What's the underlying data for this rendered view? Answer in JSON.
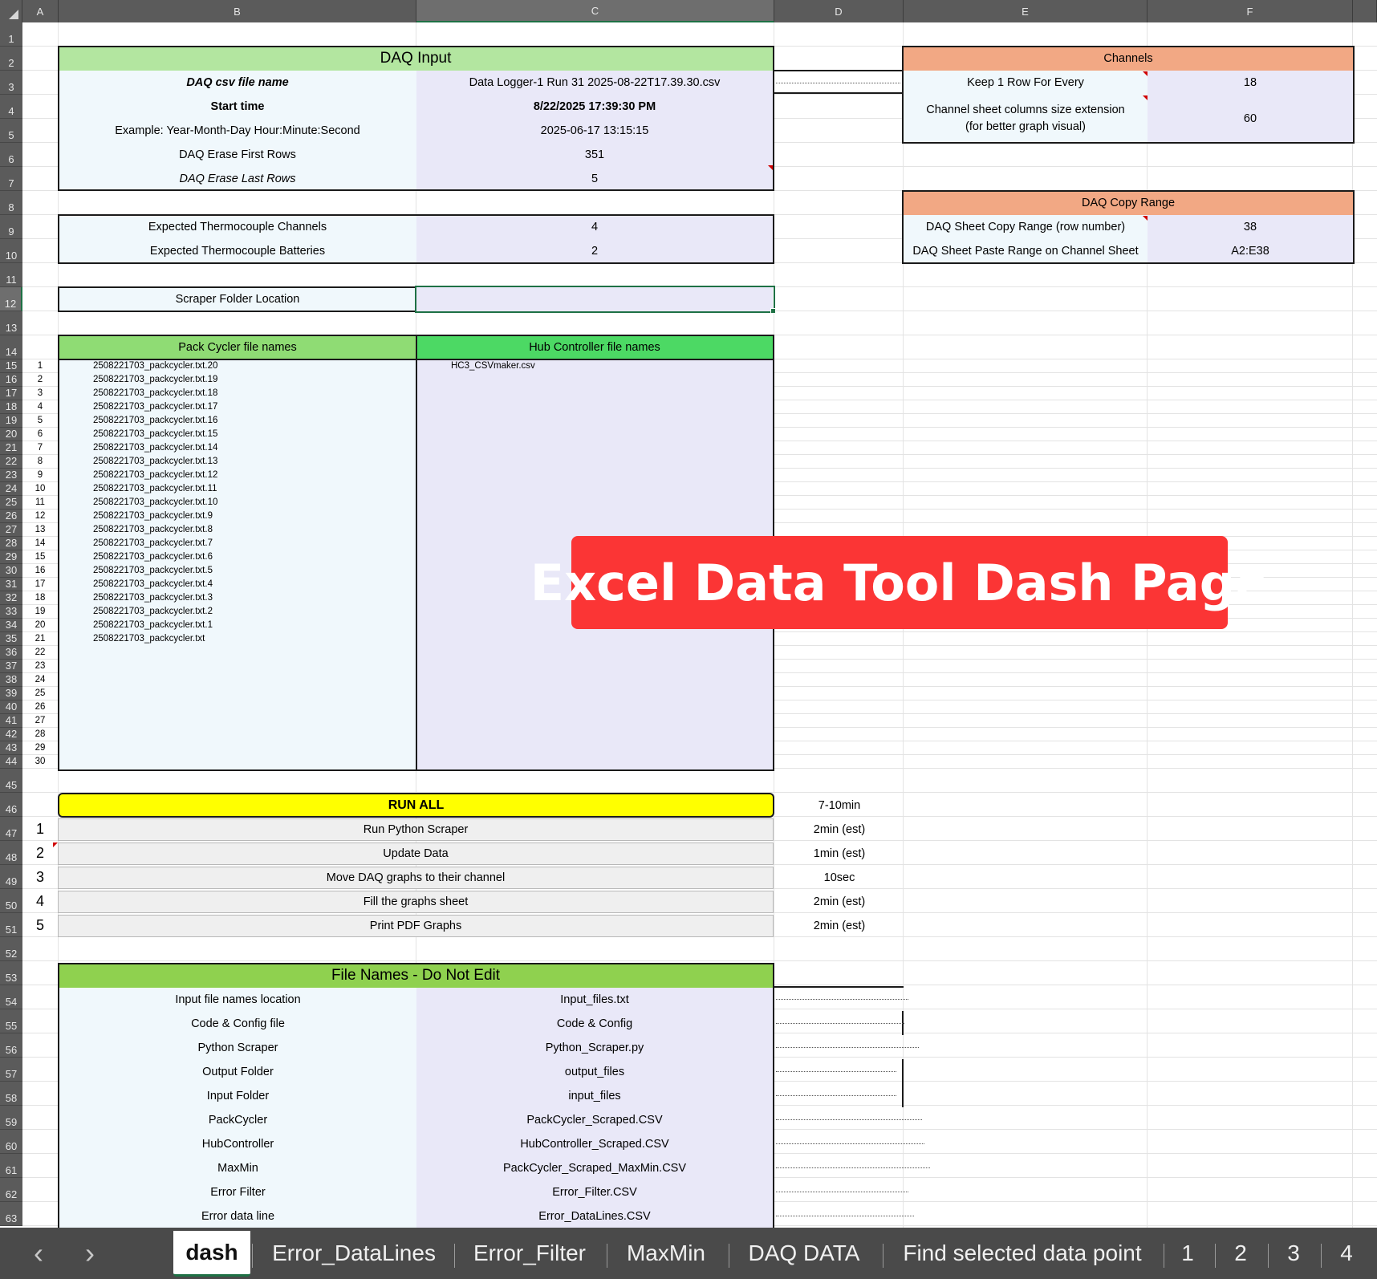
{
  "columns": [
    "A",
    "B",
    "C",
    "D",
    "E",
    "F"
  ],
  "rows": [
    "1",
    "2",
    "3",
    "4",
    "5",
    "6",
    "7",
    "8",
    "9",
    "10",
    "11",
    "12",
    "13",
    "14",
    "15",
    "16",
    "17",
    "18",
    "19",
    "20",
    "21",
    "22",
    "23",
    "24",
    "25",
    "26",
    "27",
    "28",
    "29",
    "30",
    "31",
    "32",
    "33",
    "34",
    "35",
    "36",
    "37",
    "38",
    "39",
    "40",
    "41",
    "42",
    "43",
    "44",
    "45",
    "46",
    "47",
    "48",
    "49",
    "50",
    "51",
    "52",
    "53",
    "54",
    "55",
    "56",
    "57",
    "58",
    "59",
    "60",
    "61",
    "62",
    "63"
  ],
  "daq_input": {
    "title": "DAQ Input",
    "rows": [
      {
        "label": "DAQ csv file name",
        "value": "Data Logger-1 Run 31 2025-08-22T17.39.30.csv"
      },
      {
        "label": "Start time",
        "value": "8/22/2025  17:39:30 PM"
      },
      {
        "label": "Example: Year-Month-Day Hour:Minute:Second",
        "value": "2025-06-17 13:15:15"
      },
      {
        "label": "DAQ Erase First Rows",
        "value": "351"
      },
      {
        "label": "DAQ Erase Last Rows",
        "value": "5"
      }
    ]
  },
  "thermocouple": {
    "rows": [
      {
        "label": "Expected Thermocouple Channels",
        "value": "4"
      },
      {
        "label": "Expected Thermocouple Batteries",
        "value": "2"
      }
    ]
  },
  "scraper": {
    "label": "Scraper Folder Location",
    "value": ""
  },
  "channels": {
    "title": "Channels",
    "rows": [
      {
        "label": "Keep 1 Row For Every",
        "value": "18"
      },
      {
        "label": "Channel sheet columns size extension",
        "label2": "(for better graph visual)",
        "value": "60"
      }
    ]
  },
  "copy_range": {
    "title": "DAQ Copy Range",
    "rows": [
      {
        "label": "DAQ Sheet Copy Range (row number)",
        "value": "38"
      },
      {
        "label": "DAQ Sheet Paste Range on Channel Sheet",
        "value": "A2:E38"
      }
    ]
  },
  "file_lists": {
    "pack_header": "Pack Cycler file names",
    "hub_header": "Hub Controller file names",
    "indexes": [
      "1",
      "2",
      "3",
      "4",
      "5",
      "6",
      "7",
      "8",
      "9",
      "10",
      "11",
      "12",
      "13",
      "14",
      "15",
      "16",
      "17",
      "18",
      "19",
      "20",
      "21",
      "22",
      "23",
      "24",
      "25",
      "26",
      "27",
      "28",
      "29",
      "30"
    ],
    "pack_files": [
      "2508221703_packcycler.txt.20",
      "2508221703_packcycler.txt.19",
      "2508221703_packcycler.txt.18",
      "2508221703_packcycler.txt.17",
      "2508221703_packcycler.txt.16",
      "2508221703_packcycler.txt.15",
      "2508221703_packcycler.txt.14",
      "2508221703_packcycler.txt.13",
      "2508221703_packcycler.txt.12",
      "2508221703_packcycler.txt.11",
      "2508221703_packcycler.txt.10",
      "2508221703_packcycler.txt.9",
      "2508221703_packcycler.txt.8",
      "2508221703_packcycler.txt.7",
      "2508221703_packcycler.txt.6",
      "2508221703_packcycler.txt.5",
      "2508221703_packcycler.txt.4",
      "2508221703_packcycler.txt.3",
      "2508221703_packcycler.txt.2",
      "2508221703_packcycler.txt.1",
      "2508221703_packcycler.txt"
    ],
    "hub_files": [
      "HC3_CSVmaker.csv"
    ]
  },
  "run": {
    "title": "RUN ALL",
    "total": "7-10min",
    "steps": [
      {
        "num": "1",
        "label": "Run Python Scraper",
        "est": "2min (est)"
      },
      {
        "num": "2",
        "label": "Update Data",
        "est": "1min (est)"
      },
      {
        "num": "3",
        "label": "Move DAQ graphs to their channel",
        "est": "10sec"
      },
      {
        "num": "4",
        "label": "Fill the graphs sheet",
        "est": "2min (est)"
      },
      {
        "num": "5",
        "label": "Print PDF Graphs",
        "est": "2min (est)"
      }
    ]
  },
  "file_names": {
    "title": "File Names - Do Not Edit",
    "rows": [
      {
        "label": "Input file names location",
        "value": "Input_files.txt"
      },
      {
        "label": "Code & Config file",
        "value": "Code & Config"
      },
      {
        "label": "Python Scraper",
        "value": "Python_Scraper.py"
      },
      {
        "label": "Output Folder",
        "value": "output_files"
      },
      {
        "label": "Input Folder",
        "value": "input_files"
      },
      {
        "label": "PackCycler",
        "value": "PackCycler_Scraped.CSV"
      },
      {
        "label": "HubController",
        "value": "HubController_Scraped.CSV"
      },
      {
        "label": "MaxMin",
        "value": "PackCycler_Scraped_MaxMin.CSV"
      },
      {
        "label": "Error Filter",
        "value": "Error_Filter.CSV"
      },
      {
        "label": "Error data line",
        "value": "Error_DataLines.CSV"
      }
    ]
  },
  "banner": {
    "text": "Excel Data Tool Dash Page",
    "color": "#fb3535"
  },
  "tabs": {
    "prev": "‹",
    "next": "›",
    "items": [
      "dash",
      "Error_DataLines",
      "Error_Filter",
      "MaxMin",
      "DAQ DATA",
      "Find selected data point",
      "1",
      "2",
      "3",
      "4"
    ],
    "active": "dash"
  },
  "colors": {
    "green_header": "#b3e6a0",
    "orange_header": "#f2a884",
    "label_bg": "#f0f8fc",
    "value_bg": "#e9e8f8",
    "run_all": "#ffff00",
    "hub_header": "#4cd964"
  }
}
